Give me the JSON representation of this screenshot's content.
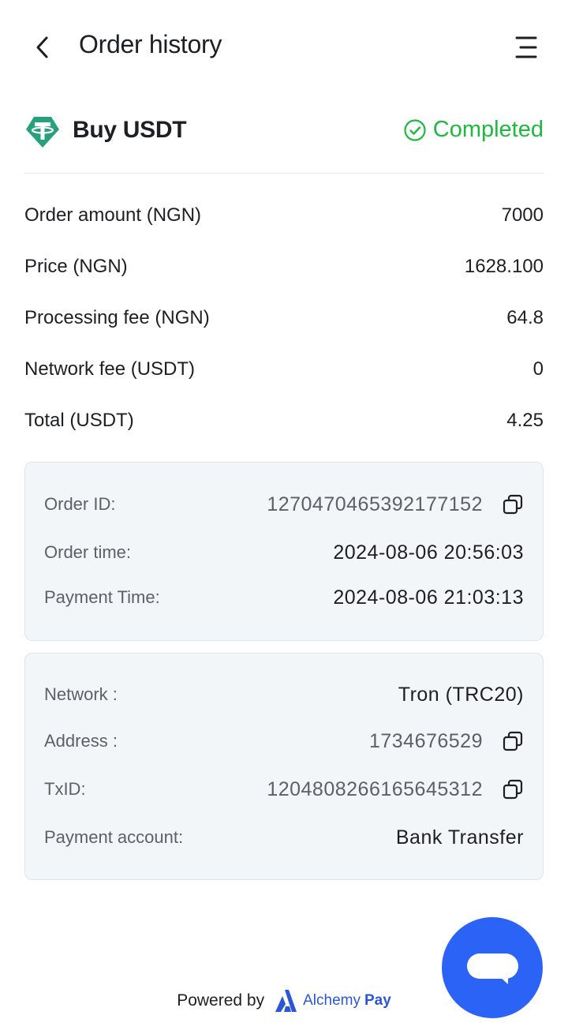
{
  "header": {
    "title": "Order history",
    "back_icon": "chevron-left-icon",
    "menu_icon": "menu-icon"
  },
  "order": {
    "title": "Buy USDT",
    "coin_icon": "tether-icon",
    "status": "Completed",
    "status_icon": "check-circle-icon",
    "status_color": "#1fb940"
  },
  "summary": [
    {
      "label": "Order amount (NGN)",
      "value": "7000"
    },
    {
      "label": "Price (NGN)",
      "value": "1628.100"
    },
    {
      "label": "Processing fee (NGN)",
      "value": "64.8"
    },
    {
      "label": "Network fee (USDT)",
      "value": "0"
    },
    {
      "label": "Total (USDT)",
      "value": "4.25"
    }
  ],
  "details": {
    "order_id_label": "Order ID:",
    "order_id": "1270470465392177152",
    "order_time_label": "Order time:",
    "order_time": "2024-08-06 20:56:03",
    "payment_time_label": "Payment Time:",
    "payment_time": "2024-08-06 21:03:13"
  },
  "network": {
    "network_label": "Network :",
    "network": "Tron (TRC20)",
    "address_label": "Address :",
    "address": "1734676529",
    "txid_label": "TxID:",
    "txid": "1204808266165645312",
    "payment_account_label": "Payment account:",
    "payment_account": "Bank Transfer"
  },
  "footer": {
    "powered_by": "Powered by",
    "brand_name": "Alchemy",
    "brand_suffix": "Pay",
    "brand_color": "#2a57d8"
  },
  "chat": {
    "icon": "chat-bubble-icon",
    "color": "#2a63f6"
  }
}
